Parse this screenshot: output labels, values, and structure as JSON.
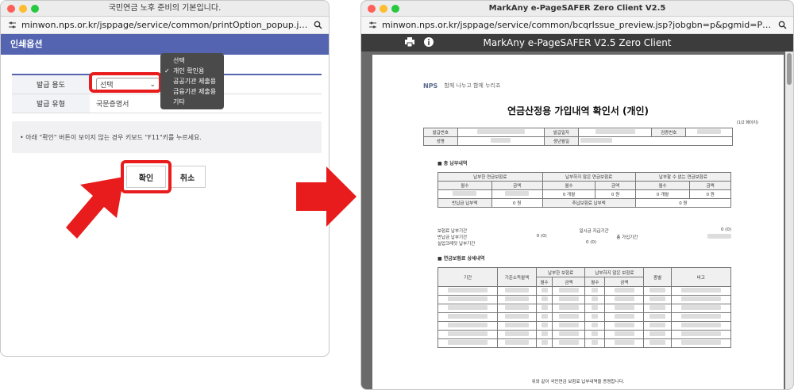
{
  "left_window": {
    "title": "국민연금 노후 준비의 기본입니다.",
    "url": "minwon.nps.or.kr/jsppage/service/common/printOption_popup.jsp?issue_lan...",
    "header": "인쇄옵션",
    "rows": [
      {
        "label": "발급 용도",
        "value": "선택"
      },
      {
        "label": "발급 유형",
        "value": "국문증명서"
      }
    ],
    "dropdown_options": [
      "선택",
      "개인 확인용",
      "공공기관 제출용",
      "금융기관 제출용",
      "기타"
    ],
    "dropdown_checked": "개인 확인용",
    "notice": "•  아래 \"확인\" 버튼이 보이지 않는 경우 키보드 \"F11\"키를 누르세요.",
    "confirm_label": "확인",
    "cancel_label": "취소"
  },
  "right_window": {
    "title": "MarkAny e-PageSAFER Zero Client V2.5",
    "url": "minwon.nps.or.kr/jsppage/service/common/bcqrIssue_preview.jsp?jobgbn=p&pgmid=PMemberPaymentI...",
    "viewer_title": "MarkAny e-PageSAFER V2.5 Zero Client",
    "doc": {
      "logo": "NPS",
      "slogan": "함께 나누고 함께 누리죠",
      "title": "연금산정용 가입내역 확인서 (개인)",
      "page": "(1/2 페이지)",
      "h_issue_no": "발급번호",
      "h_issue_date": "발급일자",
      "h_verify_no": "검증번호",
      "h_name": "성명",
      "h_birth": "생년월일",
      "sec1": "■ 총 납부내역",
      "col_paid": "납부한 연금보험료",
      "col_unpaid": "납부하지 않은 연금보험료",
      "col_exempt": "납부할 수 없는 연금보험료",
      "months": "월수",
      "amount": "금액",
      "v_unpaid_months": "0 개월",
      "v_unpaid_amount": "0 원",
      "v_exempt_months": "0 개월",
      "v_exempt_amount": "0 원",
      "refund_label": "반납금 납부액",
      "refund_value": "0 원",
      "addpay_label": "추납보험료 납부액",
      "addpay_value": "0 원",
      "s_period": "보험료 납부기간",
      "s_lump": "일시금 지급기간",
      "s_lump_val": "0 (0)",
      "s_refund_period": "반납금 납부기간",
      "s_refund_val": "0 (0)",
      "s_total_period": "총 가입기간",
      "s_credit": "실업크레딧 납부기간",
      "s_credit_val": "0 (0)",
      "sec2": "■ 연금보험료 상세내역",
      "d_period": "기간",
      "d_income": "기준소득월액",
      "d_paid": "납부한 보험료",
      "d_unpaid": "납부하지 않은 보험료",
      "d_type": "종별",
      "d_note": "비고",
      "d_months": "월수",
      "d_amount": "금액",
      "footer": "위와 같이 국민연금 보험료 납부내역을 증명합니다."
    }
  },
  "colors": {
    "accent": "#5464b0",
    "highlight": "#e81c1c"
  }
}
